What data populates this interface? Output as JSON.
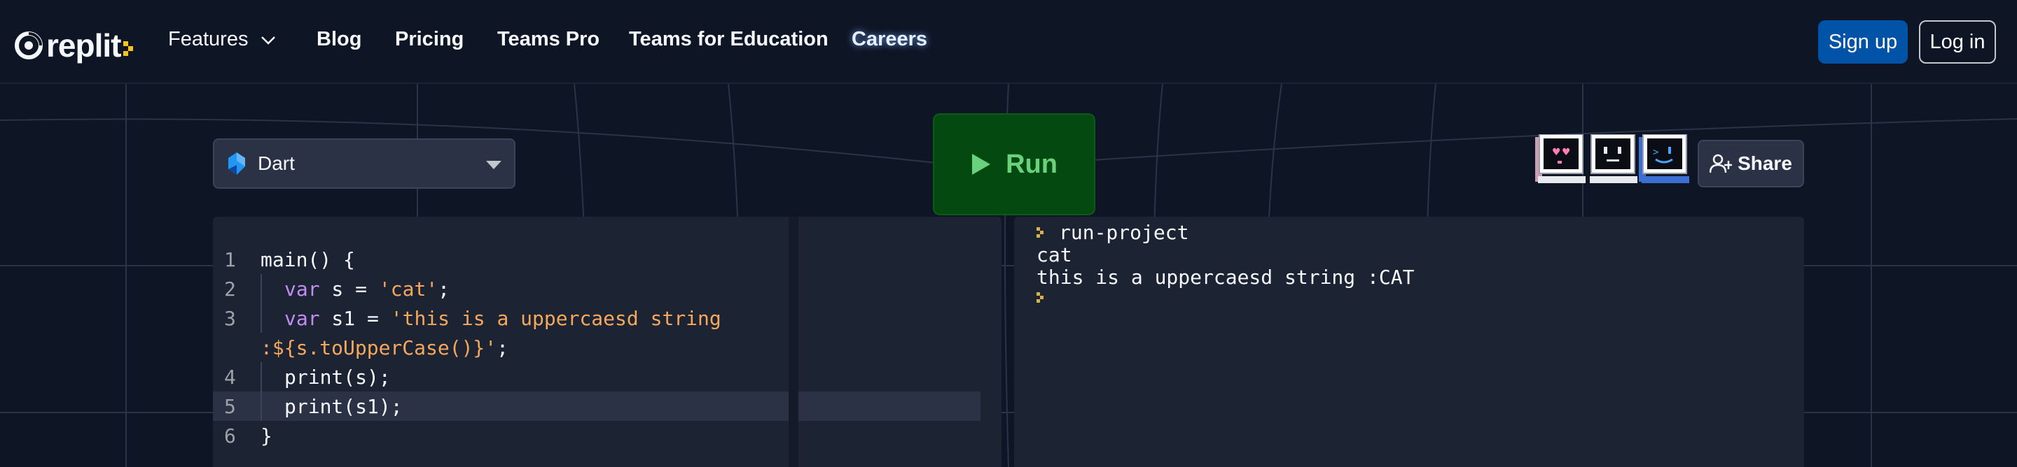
{
  "brand": {
    "name": "replit",
    "accent": "#f5c518"
  },
  "nav": {
    "features": "Features",
    "blog": "Blog",
    "pricing": "Pricing",
    "teams_pro": "Teams Pro",
    "teams_education": "Teams for Education",
    "careers": "Careers"
  },
  "auth": {
    "signup": "Sign up",
    "login": "Log in"
  },
  "toolbar": {
    "language": "Dart",
    "run_label": "Run",
    "share_label": "Share"
  },
  "editor": {
    "active_line": 5,
    "lines": [
      {
        "num": "1",
        "text": "main() {"
      },
      {
        "num": "2",
        "kw": "var",
        "rest": " s = ",
        "str": "'cat'",
        "tail": ";"
      },
      {
        "num": "3",
        "kw": "var",
        "rest": " s1 = ",
        "str": "'this is a uppercaesd string"
      },
      {
        "num": "",
        "wrap_a": ":${s.toUpperCase()}",
        "wrap_str": "'",
        "wrap_tail": ";"
      },
      {
        "num": "4",
        "text": "print(s);"
      },
      {
        "num": "5",
        "text": "print(s1);"
      },
      {
        "num": "6",
        "text": "}"
      }
    ]
  },
  "console": {
    "command": "run-project",
    "output": [
      "cat",
      "this is a uppercaesd string :CAT"
    ]
  },
  "colors": {
    "background": "#0e1525",
    "panel": "#1c2333",
    "run_green": "#044a10",
    "primary_blue": "#0053a6",
    "keyword": "#c38cf1",
    "string": "#f5a85c"
  },
  "icons": {
    "logo": "replit-logo-icon",
    "language": "dart-icon",
    "run": "play-icon",
    "share": "add-user-icon",
    "prompt": "prompt-chevron-icon"
  }
}
